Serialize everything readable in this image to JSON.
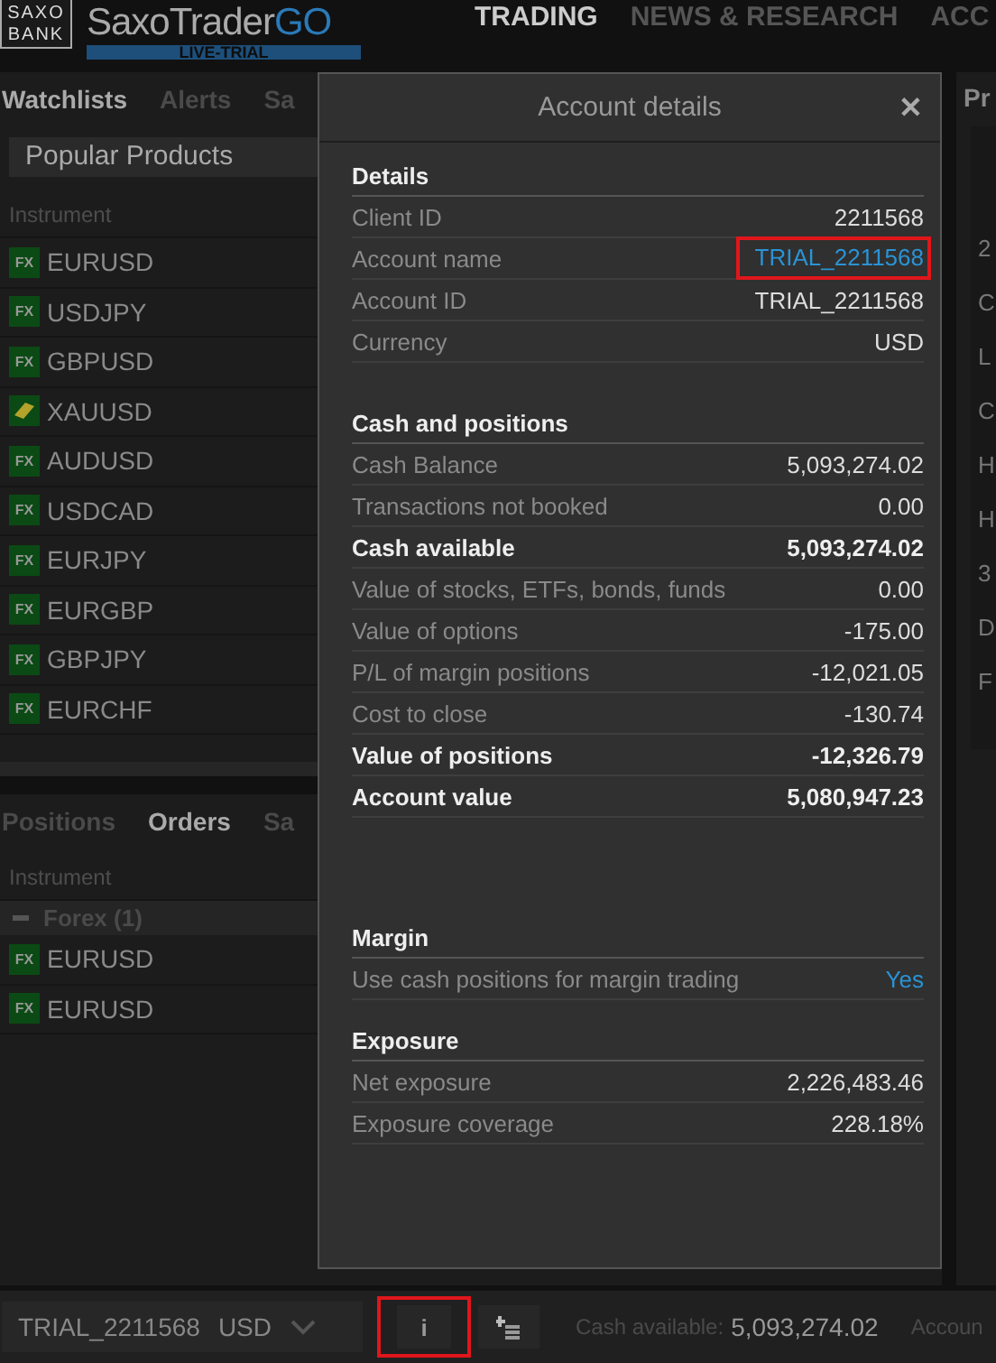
{
  "header": {
    "bank_logo_top": "SAXO",
    "bank_logo_bottom": "BANK",
    "app_name": "SaxoTrader",
    "app_suffix": "GO",
    "edition": "LIVE-TRIAL",
    "nav": [
      {
        "label": "TRADING",
        "selected": true
      },
      {
        "label": "NEWS & RESEARCH",
        "selected": false
      },
      {
        "label": "ACC",
        "selected": false
      }
    ]
  },
  "watchlist_panel": {
    "tabs": [
      {
        "label": "Watchlists",
        "selected": true
      },
      {
        "label": "Alerts",
        "selected": false
      },
      {
        "label": "Sa",
        "selected": false
      }
    ],
    "list_select": "Popular Products",
    "column": "Instrument",
    "rows": [
      {
        "kind": "fx",
        "badge": "FX",
        "name": "EURUSD"
      },
      {
        "kind": "fx",
        "badge": "FX",
        "name": "USDJPY"
      },
      {
        "kind": "fx",
        "badge": "FX",
        "name": "GBPUSD"
      },
      {
        "kind": "metal",
        "name": "XAUUSD"
      },
      {
        "kind": "fx",
        "badge": "FX",
        "name": "AUDUSD"
      },
      {
        "kind": "fx",
        "badge": "FX",
        "name": "USDCAD"
      },
      {
        "kind": "fx",
        "badge": "FX",
        "name": "EURJPY"
      },
      {
        "kind": "fx",
        "badge": "FX",
        "name": "EURGBP"
      },
      {
        "kind": "fx",
        "badge": "FX",
        "name": "GBPJPY"
      },
      {
        "kind": "fx",
        "badge": "FX",
        "name": "EURCHF"
      }
    ]
  },
  "positions_panel": {
    "tabs": [
      {
        "label": "Positions",
        "selected": false
      },
      {
        "label": "Orders",
        "selected": true
      },
      {
        "label": "Sa",
        "selected": false
      }
    ],
    "column": "Instrument",
    "groups": [
      {
        "label": "Forex (1)",
        "expanded": true,
        "children": [
          {
            "badge": "FX",
            "name": "EURUSD"
          },
          {
            "badge": "FX",
            "name": "EURUSD"
          }
        ]
      }
    ]
  },
  "right_panel": {
    "title": "Pr",
    "rows": [
      "2",
      "C",
      "L",
      "C",
      "H",
      "H",
      "3",
      "D",
      "F"
    ]
  },
  "dialog": {
    "title": "Account details",
    "close": "✕",
    "sections": [
      {
        "title": "Details",
        "rows": [
          {
            "label": "Client ID",
            "value": "2211568",
            "bold": false,
            "kind": "text",
            "highlighted": false
          },
          {
            "label": "Account name",
            "value": "TRIAL_2211568",
            "bold": false,
            "kind": "link",
            "highlighted": true
          },
          {
            "label": "Account ID",
            "value": "TRIAL_2211568",
            "bold": false,
            "kind": "text",
            "highlighted": false
          },
          {
            "label": "Currency",
            "value": "USD",
            "bold": false,
            "kind": "text",
            "highlighted": false
          }
        ]
      },
      {
        "title": "Cash and positions",
        "rows": [
          {
            "label": "Cash Balance",
            "value": "5,093,274.02",
            "bold": false,
            "kind": "text",
            "highlighted": false
          },
          {
            "label": "Transactions not booked",
            "value": "0.00",
            "bold": false,
            "kind": "text",
            "highlighted": false
          },
          {
            "label": "Cash available",
            "value": "5,093,274.02",
            "bold": true,
            "kind": "text",
            "highlighted": false
          },
          {
            "label": "Value of stocks, ETFs, bonds, funds",
            "value": "0.00",
            "bold": false,
            "kind": "text",
            "highlighted": false
          },
          {
            "label": "Value of options",
            "value": "-175.00",
            "bold": false,
            "kind": "text",
            "highlighted": false
          },
          {
            "label": "P/L of margin positions",
            "value": "-12,021.05",
            "bold": false,
            "kind": "text",
            "highlighted": false
          },
          {
            "label": "Cost to close",
            "value": "-130.74",
            "bold": false,
            "kind": "text",
            "highlighted": false
          },
          {
            "label": "Value of positions",
            "value": "-12,326.79",
            "bold": true,
            "kind": "text",
            "highlighted": false
          },
          {
            "label": "Account value",
            "value": "5,080,947.23",
            "bold": true,
            "kind": "text",
            "highlighted": false
          }
        ]
      },
      {
        "title": "Margin",
        "rows": [
          {
            "label": "Use cash positions for margin trading",
            "value": "Yes",
            "bold": false,
            "kind": "link",
            "highlighted": false
          }
        ]
      },
      {
        "title": "Exposure",
        "rows": [
          {
            "label": "Net exposure",
            "value": "2,226,483.46",
            "bold": false,
            "kind": "text",
            "highlighted": false
          },
          {
            "label": "Exposure coverage",
            "value": "228.18%",
            "bold": false,
            "kind": "text",
            "highlighted": false
          }
        ]
      }
    ]
  },
  "bottom_bar": {
    "account": "TRIAL_2211568",
    "currency": "USD",
    "info_button": {
      "label": "i",
      "highlighted": true
    },
    "cash_label": "Cash available:",
    "cash_value": "5,093,274.02",
    "next_label": "Accoun"
  }
}
